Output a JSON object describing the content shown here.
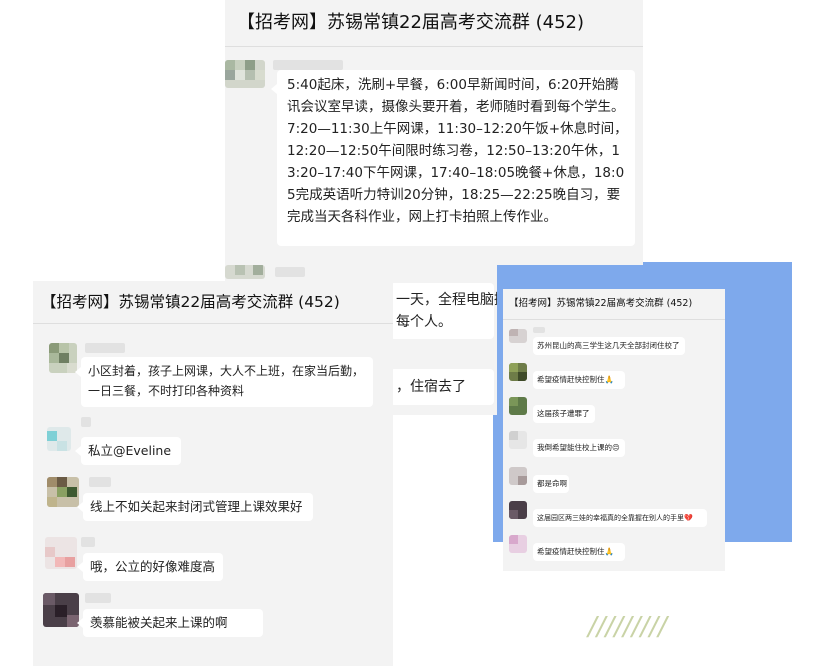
{
  "panel1": {
    "title": "【招考网】苏锡常镇22届高考交流群 (452)",
    "message": "5:40起床，洗刷+早餐，6:00早新闻时间，6:20开始腾讯会议室早读，摄像头要开着，老师随时看到每个学生。7:20—11:30上午网课，11:30–12:20午饭+休息时间，12:20—12:50午间限时练习卷，12:50–13:20午休，13:20–17:40下午网课，17:40–18:05晚餐+休息，18:05完成英语听力特训20分钟，18:25—22:25晚自习，要完成当天各科作业，网上打卡拍照上传作业。",
    "partial_1": "一天，全程电脑摄",
    "partial_2": "每个人。",
    "partial_3": "，住宿去了"
  },
  "panel2": {
    "title": "【招考网】苏锡常镇22届高考交流群 (452)",
    "messages": [
      {
        "text": "小区封着，孩子上网课，大人不上班，在家当后勤，一日三餐，不时打印各种资料"
      },
      {
        "text": "私立@Eveline"
      },
      {
        "text": "线上不如关起来封闭式管理上课效果好"
      },
      {
        "text": "哦，公立的好像难度高"
      },
      {
        "text": "羡慕能被关起来上课的啊"
      }
    ]
  },
  "panel3": {
    "title": "【招考网】苏锡常镇22届高考交流群 (452)",
    "messages": [
      {
        "text": "苏州昆山的高三学生这几天全部封闭住校了"
      },
      {
        "text": "希望疫情赶快控制住🙏"
      },
      {
        "text": "这届孩子遭罪了"
      },
      {
        "text": "我倒希望能住校上课的😔"
      },
      {
        "text": "都是命啊"
      },
      {
        "text": "这届园区两三娃的幸福真的全靠握在别人的手里💔"
      },
      {
        "text": "希望疫情赶快控制住🙏"
      }
    ]
  },
  "decor": {
    "slashes": "/////////",
    "accent_blue": "#7ea9ec",
    "accent_slash": "#c9d3a6"
  }
}
